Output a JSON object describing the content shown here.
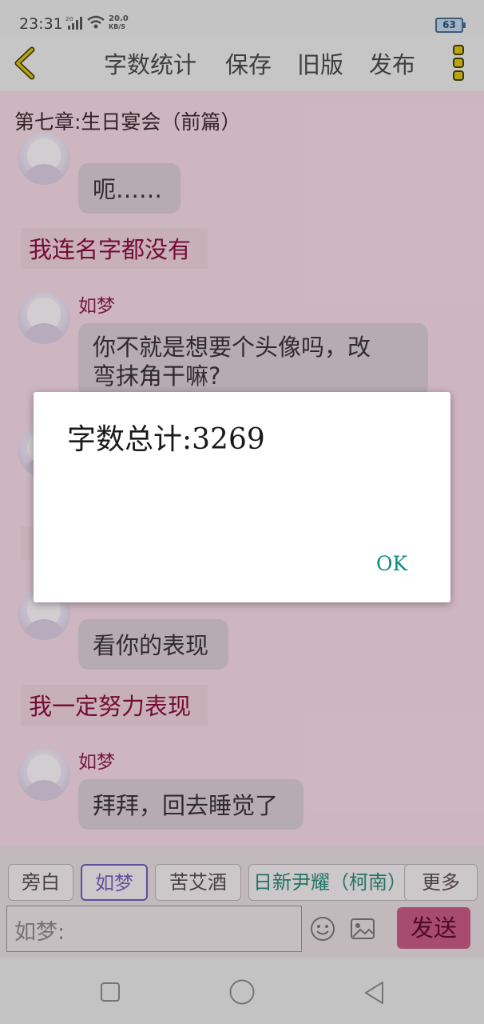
{
  "status": {
    "time": "23:31",
    "network_tag": "2G",
    "speed_value": "20.0",
    "speed_unit": "KB/S",
    "battery": "63"
  },
  "toolbar": {
    "word_count": "字数统计",
    "save": "保存",
    "old_version": "旧版",
    "publish": "发布"
  },
  "chapter_title": "第七章:生日宴会（前篇）",
  "messages": [
    {
      "type": "bubble",
      "text": "呃……"
    },
    {
      "type": "narration",
      "text": "我连名字都没有"
    },
    {
      "type": "bubble",
      "name": "如梦",
      "line1": "你不就是想要个头像吗，改",
      "line2": "弯抹角干嘛?"
    },
    {
      "type": "bubble",
      "text": "看你的表现"
    },
    {
      "type": "narration",
      "text": "我一定努力表现"
    },
    {
      "type": "bubble",
      "name": "如梦",
      "text": "拜拜，回去睡觉了"
    }
  ],
  "dialog": {
    "message": "字数总计:3269",
    "ok": "OK"
  },
  "characters": [
    "旁白",
    "如梦",
    "苦艾酒",
    "日新尹耀（柯南）"
  ],
  "more": "更多",
  "input": {
    "value": "如梦:"
  },
  "send": "发送",
  "colors": {
    "accent": "#c55a84",
    "narration": "#8a0f3c",
    "ok_button": "#0f8b80"
  }
}
